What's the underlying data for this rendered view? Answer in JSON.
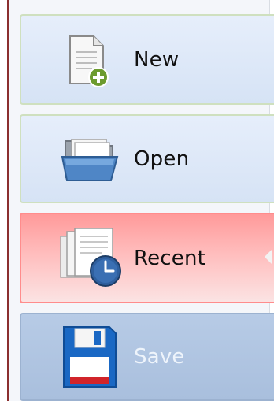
{
  "menu": {
    "items": [
      {
        "label": "New",
        "icon": "new-document-icon"
      },
      {
        "label": "Open",
        "icon": "folder-open-icon"
      },
      {
        "label": "Recent",
        "icon": "recent-documents-icon"
      },
      {
        "label": "Save",
        "icon": "save-floppy-icon"
      }
    ],
    "selected": "Recent",
    "disabled": [
      "Save"
    ]
  },
  "colors": {
    "selected_bg": "#ff9a9a",
    "item_bg": "#d6e3f5",
    "disabled_bg": "#a9bfdd"
  }
}
